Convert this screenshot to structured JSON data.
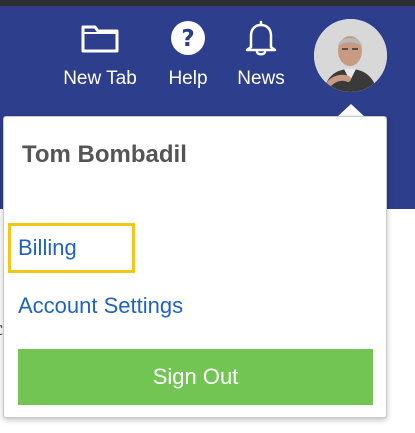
{
  "navbar": {
    "items": [
      {
        "label": "New Tab",
        "icon": "folder-icon"
      },
      {
        "label": "Help",
        "icon": "help-icon"
      },
      {
        "label": "News",
        "icon": "bell-icon"
      }
    ],
    "avatar": {
      "icon": "user-avatar"
    },
    "background": "#2c3e8c"
  },
  "dropdown": {
    "username": "Tom Bombadil",
    "links": [
      {
        "label": "Billing",
        "highlighted": true
      },
      {
        "label": "Account Settings",
        "highlighted": false
      }
    ],
    "signout_label": "Sign Out",
    "signout_color": "#72c552",
    "link_color": "#1f62c4",
    "highlight_color": "#f5c518"
  }
}
